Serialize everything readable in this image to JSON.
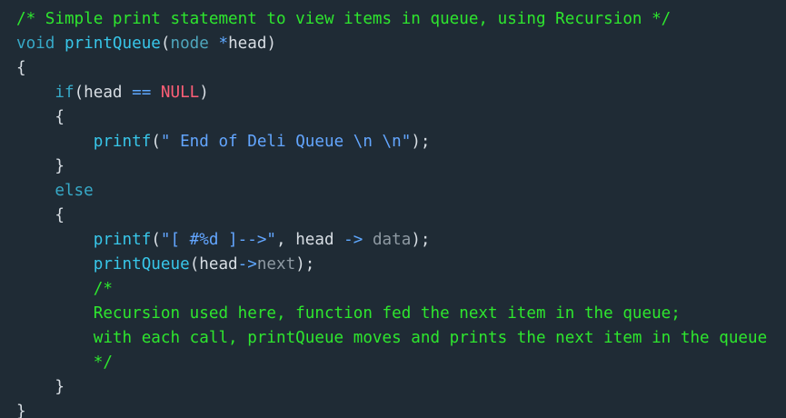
{
  "code": {
    "lines": [
      [
        {
          "text": "/* Simple print statement to view items in queue, using Recursion */",
          "kind": "comment"
        }
      ],
      [
        {
          "text": "void",
          "kind": "keyword"
        },
        {
          "text": " ",
          "kind": "punct"
        },
        {
          "text": "printQueue",
          "kind": "func"
        },
        {
          "text": "(",
          "kind": "punct"
        },
        {
          "text": "node",
          "kind": "type"
        },
        {
          "text": " ",
          "kind": "punct"
        },
        {
          "text": "*",
          "kind": "op"
        },
        {
          "text": "head",
          "kind": "ident"
        },
        {
          "text": ")",
          "kind": "punct"
        }
      ],
      [
        {
          "text": "{",
          "kind": "punct"
        }
      ],
      [
        {
          "text": "    ",
          "kind": "punct"
        },
        {
          "text": "if",
          "kind": "keyword"
        },
        {
          "text": "(head ",
          "kind": "ident"
        },
        {
          "text": "==",
          "kind": "op"
        },
        {
          "text": " ",
          "kind": "punct"
        },
        {
          "text": "NULL",
          "kind": "const"
        },
        {
          "text": ")",
          "kind": "punct"
        }
      ],
      [
        {
          "text": "    {",
          "kind": "punct"
        }
      ],
      [
        {
          "text": "        ",
          "kind": "punct"
        },
        {
          "text": "printf",
          "kind": "func"
        },
        {
          "text": "(",
          "kind": "punct"
        },
        {
          "text": "\" End of Deli Queue \\n \\n\"",
          "kind": "string"
        },
        {
          "text": ");",
          "kind": "punct"
        }
      ],
      [
        {
          "text": "    }",
          "kind": "punct"
        }
      ],
      [
        {
          "text": "    ",
          "kind": "punct"
        },
        {
          "text": "else",
          "kind": "keyword"
        }
      ],
      [
        {
          "text": "    {",
          "kind": "punct"
        }
      ],
      [
        {
          "text": "        ",
          "kind": "punct"
        },
        {
          "text": "printf",
          "kind": "func"
        },
        {
          "text": "(",
          "kind": "punct"
        },
        {
          "text": "\"[ #%d ]-->\"",
          "kind": "string"
        },
        {
          "text": ", head ",
          "kind": "punct"
        },
        {
          "text": "->",
          "kind": "op"
        },
        {
          "text": " ",
          "kind": "punct"
        },
        {
          "text": "data",
          "kind": "member"
        },
        {
          "text": ");",
          "kind": "punct"
        }
      ],
      [
        {
          "text": "        ",
          "kind": "punct"
        },
        {
          "text": "printQueue",
          "kind": "func"
        },
        {
          "text": "(head",
          "kind": "ident"
        },
        {
          "text": "->",
          "kind": "op"
        },
        {
          "text": "next",
          "kind": "member"
        },
        {
          "text": ");",
          "kind": "punct"
        }
      ],
      [
        {
          "text": "        /*",
          "kind": "comment"
        }
      ],
      [
        {
          "text": "        Recursion used here, function fed the next item in the queue;",
          "kind": "comment"
        }
      ],
      [
        {
          "text": "        with each call, printQueue moves and prints the next item in the queue",
          "kind": "comment"
        }
      ],
      [
        {
          "text": "        */",
          "kind": "comment"
        }
      ],
      [
        {
          "text": "    }",
          "kind": "punct"
        }
      ],
      [
        {
          "text": "}",
          "kind": "punct"
        }
      ]
    ]
  }
}
